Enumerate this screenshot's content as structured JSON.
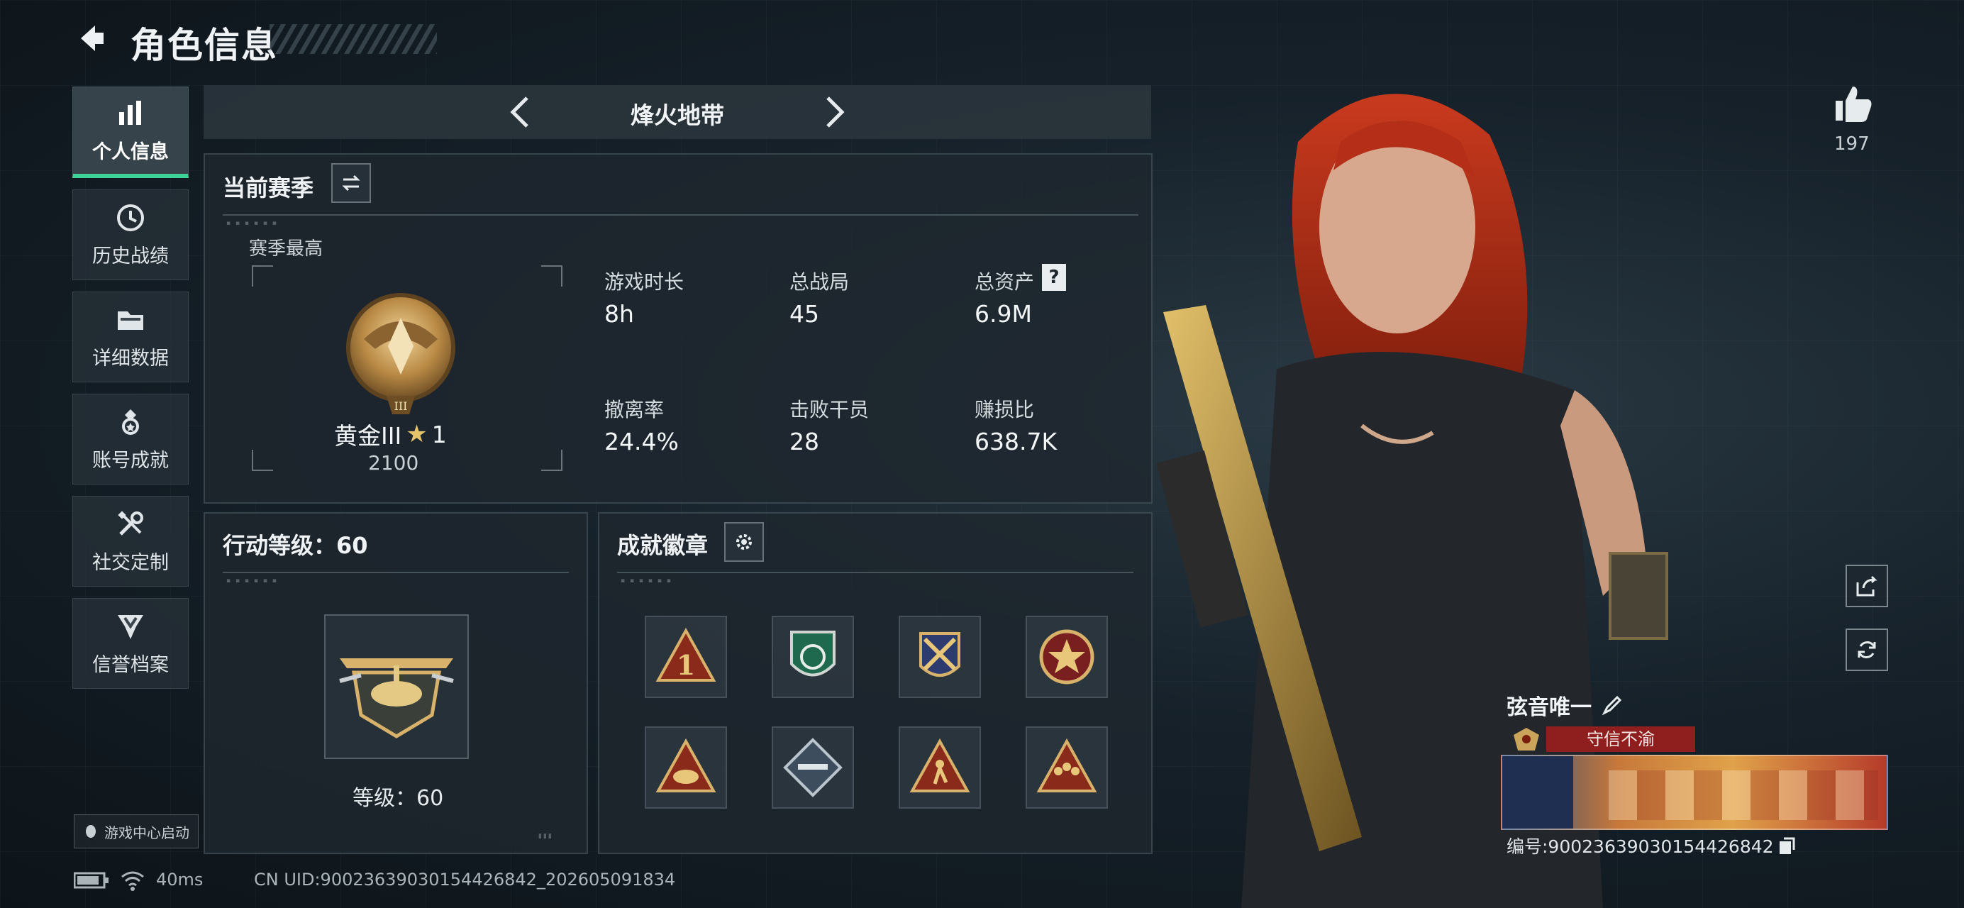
{
  "header": {
    "title": "角色信息"
  },
  "nav": [
    {
      "key": "personal",
      "label": "个人信息",
      "icon": "bar-chart-icon",
      "active": true
    },
    {
      "key": "history",
      "label": "历史战绩",
      "icon": "clock-history-icon"
    },
    {
      "key": "detail",
      "label": "详细数据",
      "icon": "folder-icon"
    },
    {
      "key": "achievements",
      "label": "账号成就",
      "icon": "medal-icon"
    },
    {
      "key": "social",
      "label": "社交定制",
      "icon": "tools-icon"
    },
    {
      "key": "credit",
      "label": "信誉档案",
      "icon": "shield-rank-icon"
    }
  ],
  "launch_label": "游戏中心启动",
  "mode": {
    "name": "烽火地带"
  },
  "season": {
    "title": "当前赛季",
    "best_label": "赛季最高",
    "rank_name": "黄金III",
    "rank_stars": "1",
    "rank_points": "2100",
    "stats": [
      {
        "label": "游戏时长",
        "value": "8h"
      },
      {
        "label": "总战局",
        "value": "45"
      },
      {
        "label": "总资产",
        "value": "6.9M",
        "help": "?"
      },
      {
        "label": "撤离率",
        "value": "24.4%"
      },
      {
        "label": "击败干员",
        "value": "28"
      },
      {
        "label": "赚损比",
        "value": "638.7K"
      }
    ]
  },
  "action_level": {
    "title": "行动等级：60",
    "level_text": "等级：60"
  },
  "badges": {
    "title": "成就徽章",
    "items": [
      "triangle-one-badge",
      "green-shield-badge",
      "crossed-emblem-badge",
      "red-star-badge",
      "triangle-hand-badge",
      "diamond-rifle-badge",
      "triangle-runner-badge",
      "triangle-group-badge"
    ]
  },
  "profile": {
    "likes": "197",
    "name": "弦音唯一",
    "reputation": "守信不渝",
    "id_text": "编号:90023639030154426842"
  },
  "footer": {
    "ping": "40ms",
    "uid": "CN UID:90023639030154426842_202605091834"
  },
  "colors": {
    "accent_green": "#3fd39a",
    "reputation_red": "#8f1e1e",
    "gold": "#c9a45a"
  }
}
